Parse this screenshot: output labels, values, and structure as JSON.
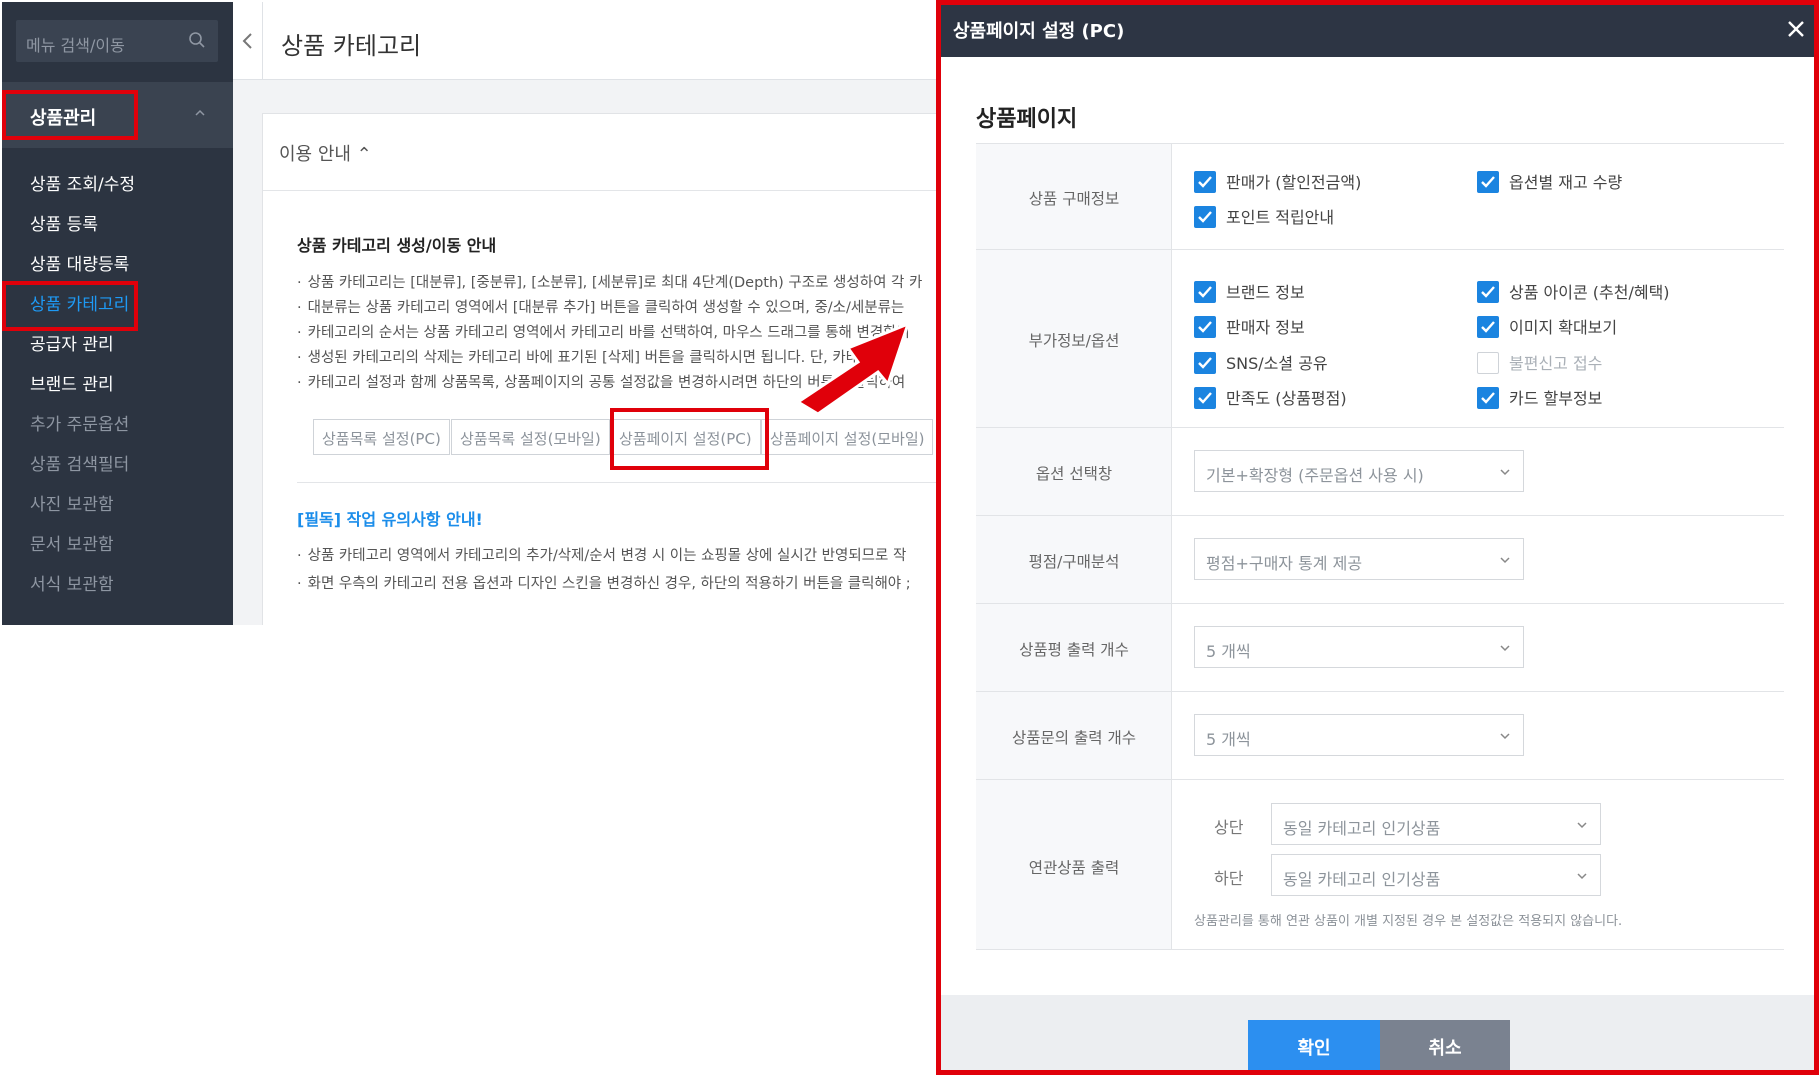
{
  "sidebar": {
    "search_placeholder": "메뉴 검색/이동",
    "section_label": "상품관리",
    "items": [
      {
        "label": "상품 조회/수정"
      },
      {
        "label": "상품 등록"
      },
      {
        "label": "상품 대량등록"
      },
      {
        "label": "상품 카테고리"
      },
      {
        "label": "공급자 관리"
      },
      {
        "label": "브랜드 관리"
      },
      {
        "label": "추가 주문옵션"
      },
      {
        "label": "상품 검색필터"
      },
      {
        "label": "사진 보관함"
      },
      {
        "label": "문서 보관함"
      },
      {
        "label": "서식 보관함"
      }
    ]
  },
  "page": {
    "title": "상품 카테고리",
    "guide_toggle": "이용 안내 ⌃",
    "guide_title": "상품 카테고리 생성/이동 안내",
    "guide_bullets": [
      "상품 카테고리는 [대분류], [중분류], [소분류], [세분류]로 최대 4단계(Depth) 구조로 생성하여 각 카",
      "대분류는 상품 카테고리 영역에서 [대분류 추가] 버튼을 클릭하여 생성할 수 있으며, 중/소/세분류는",
      "카테고리의 순서는 상품 카테고리 영역에서 카테고리 바를 선택하여, 마우스 드래그를 통해 변경합니",
      "생성된 카테고리의 삭제는 카테고리 바에 표기된 [삭제] 버튼을 클릭하시면 됩니다. 단, 카테고리",
      "카테고리 설정과 함께 상품목록, 상품페이지의 공통 설정값을 변경하시려면 하단의 버튼을 클릭하여"
    ],
    "buttons": [
      "상품목록 설정(PC)",
      "상품목록 설정(모바일)",
      "상품페이지 설정(PC)",
      "상품페이지 설정(모바일)"
    ],
    "notice_title": "[필독] 작업 유의사항 안내!",
    "notice_bullets": [
      "상품 카테고리 영역에서 카테고리의 추가/삭제/순서 변경 시 이는 쇼핑몰 상에 실시간 반영되므로 작",
      "화면 우측의 카테고리 전용 옵션과 디자인 스킨을 변경하신 경우, 하단의 적용하기 버튼을 클릭해야 ;"
    ]
  },
  "modal": {
    "title": "상품페이지 설정 (PC)",
    "section_title": "상품페이지",
    "rows": {
      "purchase": {
        "label": "상품 구매정보",
        "checks": [
          {
            "label": "판매가 (할인전금액)",
            "checked": true
          },
          {
            "label": "옵션별 재고 수량",
            "checked": true
          },
          {
            "label": "포인트 적립안내",
            "checked": true
          }
        ]
      },
      "extra": {
        "label": "부가정보/옵션",
        "checks": [
          {
            "label": "브랜드 정보",
            "checked": true
          },
          {
            "label": "상품 아이콘 (추천/혜택)",
            "checked": true
          },
          {
            "label": "판매자 정보",
            "checked": true
          },
          {
            "label": "이미지 확대보기",
            "checked": true
          },
          {
            "label": "SNS/소셜 공유",
            "checked": true
          },
          {
            "label": "불편신고 접수",
            "checked": false
          },
          {
            "label": "만족도 (상품평점)",
            "checked": true
          },
          {
            "label": "카드 할부정보",
            "checked": true
          }
        ]
      },
      "option_window": {
        "label": "옵션 선택창",
        "value": "기본+확장형 (주문옵션 사용 시)"
      },
      "review_analysis": {
        "label": "평점/구매분석",
        "value": "평점+구매자 통계 제공"
      },
      "review_count": {
        "label": "상품평 출력 개수",
        "value": "5 개씩"
      },
      "qna_count": {
        "label": "상품문의 출력 개수",
        "value": "5 개씩"
      },
      "related": {
        "label": "연관상품 출력",
        "top_label": "상단",
        "top_value": "동일 카테고리 인기상품",
        "bottom_label": "하단",
        "bottom_value": "동일 카테고리 인기상품",
        "hint": "상품관리를 통해 연관 상품이 개별 지정된 경우 본 설정값은 적용되지 않습니다."
      }
    },
    "ok_label": "확인",
    "cancel_label": "취소"
  },
  "colors": {
    "sidebar_bg": "#2c3441",
    "active_menu": "#1e9af5",
    "highlight_red": "#e0000a",
    "checkbox_blue": "#1b84e0",
    "ok_button": "#2c8ff0",
    "cancel_button": "#7a8290"
  },
  "icons": [
    "search-icon",
    "chevron-up-icon",
    "back-chevron-icon",
    "close-icon",
    "checkmark-icon",
    "caret-down-icon",
    "arrow-icon"
  ]
}
